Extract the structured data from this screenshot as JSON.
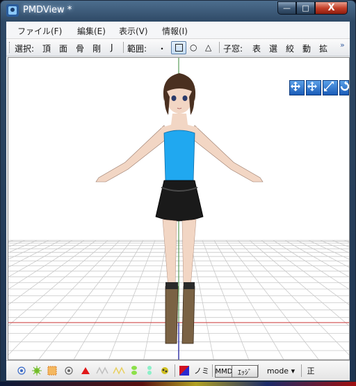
{
  "window": {
    "title": "PMDView *",
    "controls": {
      "minimize": "—",
      "maximize": "□",
      "close": "X"
    }
  },
  "menu": [
    "ファイル(F)",
    "編集(E)",
    "表示(V)",
    "情報(I)"
  ],
  "toolbar": {
    "select_label": "選択:",
    "select_items": [
      "頂",
      "面",
      "骨",
      "剛",
      "J"
    ],
    "range_label": "範囲:",
    "range_items": [
      "・",
      "□",
      "○",
      "△"
    ],
    "child_label": "子窓:",
    "child_items": [
      "表",
      "選",
      "絞",
      "動",
      "拡"
    ],
    "more": "»"
  },
  "viewport": {
    "background": "#ffffff",
    "grid_color": "#c8c8c8",
    "axis_colors": {
      "y": "#3a8a3a",
      "x": "#c83232",
      "z": "#3a3aa8"
    },
    "nav_icons": [
      "rotate-move-icon",
      "pan-icon",
      "zoom-icon",
      "reset-rotation-icon"
    ],
    "model_colors": {
      "top": "#20a8f0",
      "skirt": "#1a1a1a",
      "hair": "#4a3020",
      "skin": "#f2d6c4",
      "boots": "#7a6244"
    }
  },
  "statusbar": {
    "icons": [
      "vertex-view-icon",
      "material-icon",
      "texture-icon",
      "bone-view-icon",
      "ik-icon",
      "morph-icon",
      "physics-body-icon",
      "joint-icon",
      "shadow-icon",
      "color-icon"
    ],
    "nomi": "ノミ",
    "mmd": "MMD",
    "edge": "ｴｯｼﾞ",
    "mode": "mode",
    "mode_arrow": "▾",
    "view": "正"
  }
}
